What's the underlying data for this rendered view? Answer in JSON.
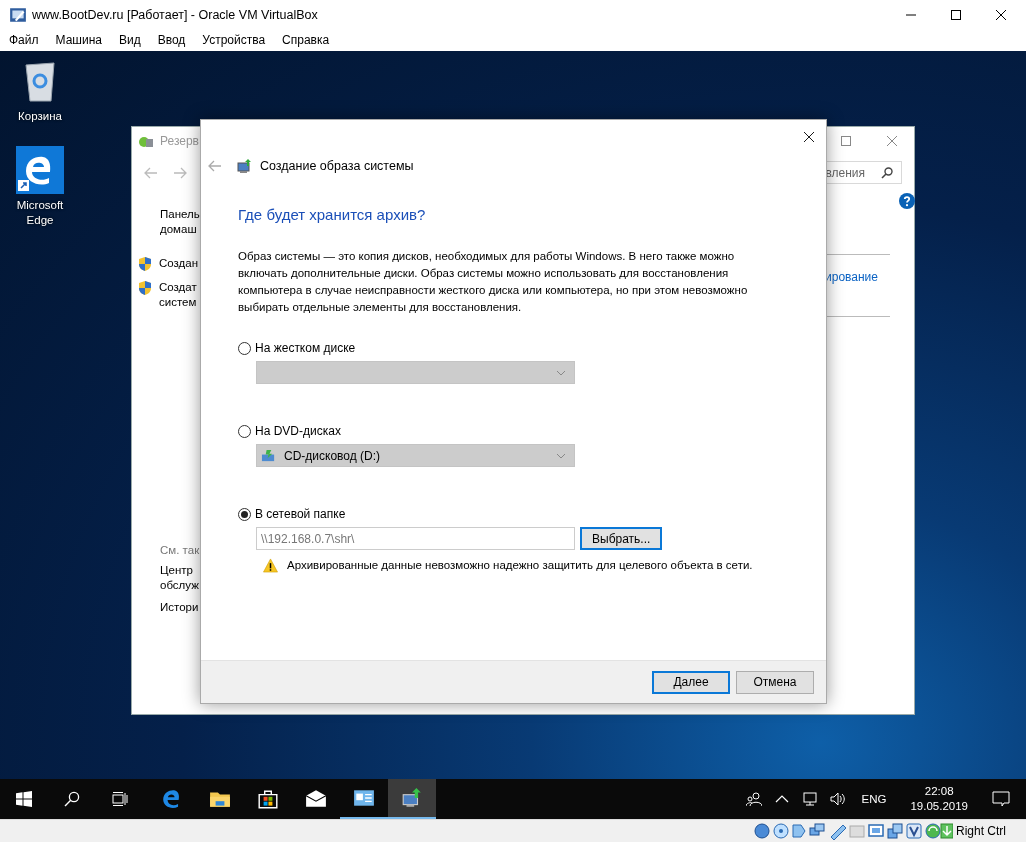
{
  "host_window": {
    "title": "www.BootDev.ru [Работает] - Oracle VM VirtualBox"
  },
  "menu": [
    "Файл",
    "Машина",
    "Вид",
    "Ввод",
    "Устройства",
    "Справка"
  ],
  "desktop_icons": [
    {
      "kind": "recycle",
      "label": "Корзина"
    },
    {
      "kind": "edge",
      "label": "Microsoft Edge"
    }
  ],
  "background_window": {
    "title": "Резерв",
    "search": {
      "value": "вления"
    },
    "nav_items": [
      {
        "lines": [
          "Панель",
          "домаш"
        ]
      }
    ],
    "tasks": [
      {
        "lines": [
          "Создан"
        ]
      },
      {
        "lines": [
          "Создат",
          "систем"
        ]
      }
    ],
    "see_also_heading": "См. так",
    "see_also": [
      {
        "lines": [
          "Центр",
          "обслуж"
        ]
      },
      {
        "lines": [
          "Истори"
        ]
      }
    ],
    "link": "ирование"
  },
  "dialog": {
    "title": "Создание образа системы",
    "heading": "Где будет хранится архив?",
    "description": "Образ системы — это копия дисков, необходимых для работы Windows. В него также можно включать дополнительные диски. Образ системы можно использовать для восстановления компьютера в случае неисправности жесткого диска или компьютера, но при этом невозможно выбирать отдельные элементы для восстановления.",
    "options": [
      {
        "kind": "combo",
        "label": "На жестком диске",
        "selected": false,
        "disabled": true
      },
      {
        "kind": "combo",
        "label": "На DVD-дисках",
        "selected": false,
        "disabled": true,
        "value": "CD-дисковод (D:)"
      },
      {
        "kind": "path",
        "label": "В сетевой папке",
        "selected": true,
        "value": "\\\\192.168.0.7\\shr\\",
        "button": {
          "label": "Выбрать...",
          "focused": true
        }
      }
    ],
    "warning": "Архивированные данные невозможно надежно защитить для целевого объекта в сети.",
    "buttons": [
      {
        "label": "Далее",
        "default": true
      },
      {
        "label": "Отмена",
        "default": false
      }
    ]
  },
  "taskbar": {
    "items": [
      {
        "kind": "start",
        "running": false,
        "selected": false
      },
      {
        "kind": "search",
        "running": false,
        "selected": false
      },
      {
        "kind": "taskview",
        "running": false,
        "selected": false
      },
      {
        "kind": "edge",
        "running": false,
        "selected": false
      },
      {
        "kind": "explorer",
        "running": false,
        "selected": false
      },
      {
        "kind": "store",
        "running": false,
        "selected": false
      },
      {
        "kind": "mail",
        "running": false,
        "selected": false
      },
      {
        "kind": "control",
        "running": true,
        "selected": false
      },
      {
        "kind": "backup",
        "running": true,
        "selected": true
      }
    ],
    "language": "ENG",
    "time": "22:08",
    "date": "19.05.2019"
  },
  "status_bar": {
    "host_key": "Right Ctrl"
  }
}
